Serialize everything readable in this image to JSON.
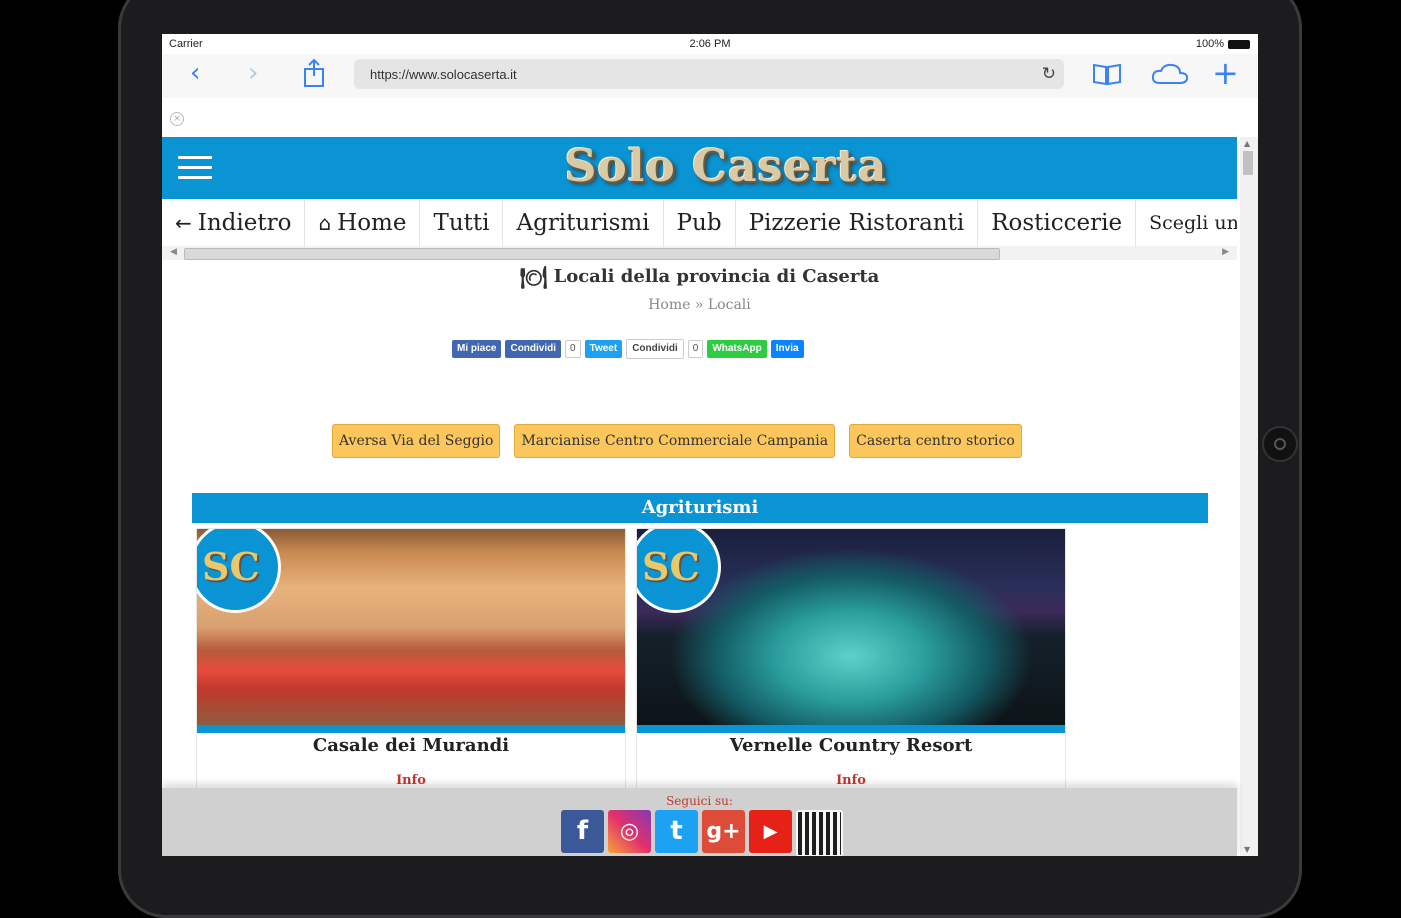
{
  "status_bar": {
    "carrier": "Carrier",
    "time": "2:06 PM",
    "battery": "100%"
  },
  "browser": {
    "url": "https://www.solocaserta.it",
    "icons": {
      "back": "chevron-left-icon",
      "forward": "chevron-right-icon",
      "share": "share-icon",
      "reload": "reload-icon",
      "bookmarks": "book-icon",
      "cloud": "cloud-icon",
      "new_tab": "plus-icon"
    }
  },
  "site": {
    "logo": "Solo Caserta",
    "nav": [
      {
        "label": "Indietro",
        "icon": "←"
      },
      {
        "label": "Home",
        "icon": "⌂"
      },
      {
        "label": "Tutti"
      },
      {
        "label": "Agriturismi"
      },
      {
        "label": "Pub"
      },
      {
        "label": "Pizzerie Ristoranti"
      },
      {
        "label": "Rosticcerie"
      },
      {
        "label": "Scegli un"
      }
    ],
    "page_title": "Locali della provincia di Caserta",
    "breadcrumb": "Home » Locali"
  },
  "share": {
    "fb_like": "Mi piace",
    "fb_share": "Condividi",
    "fb_count": "0",
    "tweet": "Tweet",
    "gplus": "Condividi",
    "gplus_count": "0",
    "whatsapp": "WhatsApp",
    "messenger": "Invia"
  },
  "locations": [
    "Aversa Via del Seggio",
    "Marcianise Centro Commerciale Campania",
    "Caserta centro storico"
  ],
  "section": {
    "title": "Agriturismi",
    "cards": [
      {
        "title": "Casale dei Murandi",
        "badge": "SC",
        "info": "Info"
      },
      {
        "title": "Vernelle Country Resort",
        "badge": "SC",
        "info": "Info"
      }
    ]
  },
  "footer": {
    "label": "Seguici su:",
    "social": [
      "f",
      "◎",
      "t",
      "g+",
      "▶",
      ""
    ]
  },
  "colors": {
    "brand_blue": "#0a94d3",
    "location_button": "#fbc65c",
    "footer_bg": "#d0d0d0"
  }
}
